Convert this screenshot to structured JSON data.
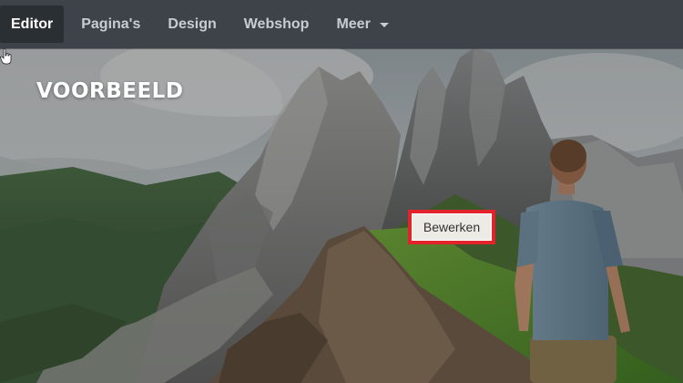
{
  "topnav": {
    "items": [
      {
        "label": "Editor",
        "active": true
      },
      {
        "label": "Pagina's",
        "active": false
      },
      {
        "label": "Design",
        "active": false
      },
      {
        "label": "Webshop",
        "active": false
      },
      {
        "label": "Meer",
        "active": false,
        "has_dropdown": true
      }
    ]
  },
  "hero": {
    "title": "VOORBEELD",
    "edit_button_label": "Bewerken",
    "highlight_color": "#e3232b"
  },
  "icons": {
    "more_dropdown": "chevron-down-icon",
    "pointer": "hand-pointer-icon"
  }
}
